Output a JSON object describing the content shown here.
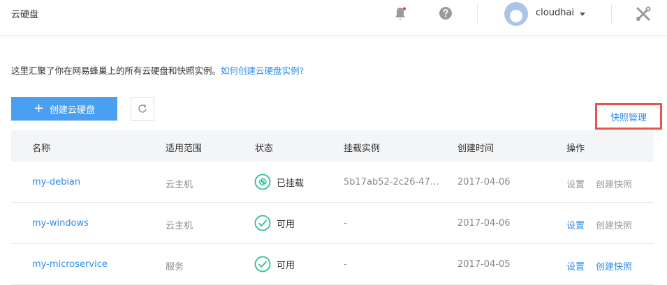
{
  "header": {
    "title": "云硬盘",
    "username": "cloudhai",
    "colors": {
      "notification_dot": "#e0473e",
      "icon": "#999999"
    }
  },
  "intro": {
    "text": "这里汇聚了你在网易蜂巢上的所有云硬盘和快照实例。",
    "link": "如何创建云硬盘实例?"
  },
  "toolbar": {
    "create_label": "创建云硬盘",
    "snapshot_manage_label": "快照管理"
  },
  "table": {
    "columns": [
      "名称",
      "适用范围",
      "状态",
      "挂载实例",
      "创建时间",
      "操作"
    ],
    "rows": [
      {
        "name": "my-debian",
        "scope": "云主机",
        "status": "已挂载",
        "status_icon": "link-icon",
        "instance": "5b17ab52-2c26-47…",
        "created": "2017-04-06",
        "action_settings": "设置",
        "action_snapshot": "创建快照",
        "settings_enabled": false,
        "snapshot_enabled": false
      },
      {
        "name": "my-windows",
        "scope": "云主机",
        "status": "可用",
        "status_icon": "check-icon",
        "instance": "-",
        "created": "2017-04-06",
        "action_settings": "设置",
        "action_snapshot": "创建快照",
        "settings_enabled": true,
        "snapshot_enabled": false
      },
      {
        "name": "my-microservice",
        "scope": "服务",
        "status": "可用",
        "status_icon": "check-icon",
        "instance": "-",
        "created": "2017-04-05",
        "action_settings": "设置",
        "action_snapshot": "创建快照",
        "settings_enabled": true,
        "snapshot_enabled": true
      }
    ]
  },
  "colors": {
    "accent": "#2d8cf0",
    "status_green": "#2fbf8f",
    "highlight_border": "#e8534d",
    "button_bg": "#4a9ff0"
  }
}
